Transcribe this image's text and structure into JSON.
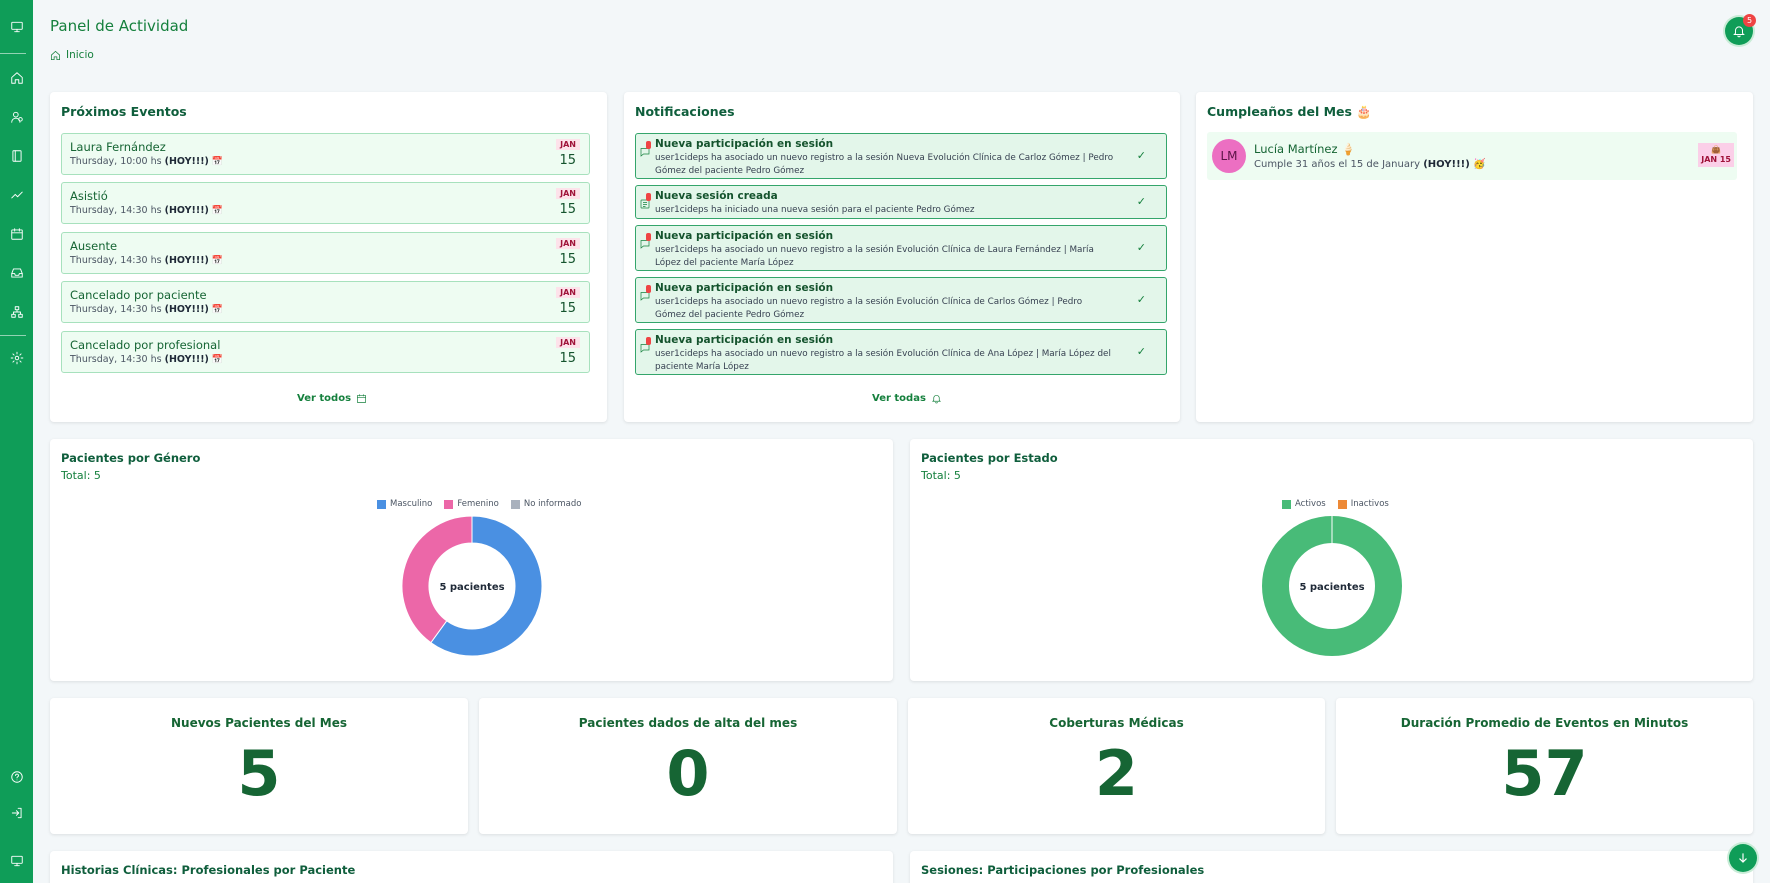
{
  "header": {
    "title": "Panel de Actividad",
    "breadcrumb": "Inicio",
    "notification_count": "5"
  },
  "sidebar": {
    "top_icons": [
      "monitor-icon"
    ],
    "items": [
      "home-icon",
      "patients-icon",
      "book-icon",
      "chart-icon",
      "calendar-icon",
      "inbox-icon",
      "sitemap-icon"
    ],
    "settings_icon": "gear-icon",
    "bottom_icons": [
      "help-icon",
      "logout-icon",
      "monitor-icon"
    ]
  },
  "events": {
    "title": "Próximos Eventos",
    "see_all": "Ver todos",
    "items": [
      {
        "name": "Laura Fernández",
        "time": "Thursday, 10:00 hs",
        "today": "(HOY!!!)",
        "month": "JAN",
        "day": "15"
      },
      {
        "name": "Asistió",
        "time": "Thursday, 14:30 hs",
        "today": "(HOY!!!)",
        "month": "JAN",
        "day": "15"
      },
      {
        "name": "Ausente",
        "time": "Thursday, 14:30 hs",
        "today": "(HOY!!!)",
        "month": "JAN",
        "day": "15"
      },
      {
        "name": "Cancelado por paciente",
        "time": "Thursday, 14:30 hs",
        "today": "(HOY!!!)",
        "month": "JAN",
        "day": "15"
      },
      {
        "name": "Cancelado por profesional",
        "time": "Thursday, 14:30 hs",
        "today": "(HOY!!!)",
        "month": "JAN",
        "day": "15"
      }
    ]
  },
  "notifications": {
    "title": "Notificaciones",
    "see_all": "Ver todas",
    "items": [
      {
        "icon": "chat-icon",
        "title": "Nueva participación en sesión",
        "text": "user1cideps ha asociado un nuevo registro a la sesión Nueva Evolución Clínica de Carloz Gómez | Pedro Gómez del paciente Pedro Gómez"
      },
      {
        "icon": "session-icon",
        "title": "Nueva sesión creada",
        "text": "user1cideps ha iniciado una nueva sesión para el paciente Pedro Gómez"
      },
      {
        "icon": "chat-icon",
        "title": "Nueva participación en sesión",
        "text": "user1cideps ha asociado un nuevo registro a la sesión Evolución Clínica de Laura Fernández | María López del paciente María López"
      },
      {
        "icon": "chat-icon",
        "title": "Nueva participación en sesión",
        "text": "user1cideps ha asociado un nuevo registro a la sesión Evolución Clínica de Carlos Gómez | Pedro Gómez del paciente Pedro Gómez"
      },
      {
        "icon": "chat-icon",
        "title": "Nueva participación en sesión",
        "text": "user1cideps ha asociado un nuevo registro a la sesión Evolución Clínica de Ana López | María López del paciente María López"
      }
    ]
  },
  "birthdays": {
    "title": "Cumpleaños del Mes 🎂",
    "items": [
      {
        "initials": "LM",
        "name": "Lucía Martínez 🍦",
        "text": "Cumple 31 años el 15 de January",
        "today": "(HOY!!!) 🥳",
        "date_icon": "👜",
        "date": "JAN 15"
      }
    ]
  },
  "charts_text": {
    "gender_title": "Pacientes por Género",
    "gender_total": "Total: 5",
    "gender_center": "5 pacientes",
    "status_title": "Pacientes por Estado",
    "status_total": "Total: 5",
    "status_center": "5 pacientes"
  },
  "chart_data": [
    {
      "type": "pie",
      "title": "Pacientes por Género",
      "categories": [
        "Masculino",
        "Femenino",
        "No informado"
      ],
      "values": [
        3,
        2,
        0
      ],
      "colors": [
        "#4a90e2",
        "#ec67a8",
        "#a9b1bd"
      ],
      "legend": "top"
    },
    {
      "type": "pie",
      "title": "Pacientes por Estado",
      "categories": [
        "Activos",
        "Inactivos"
      ],
      "values": [
        5,
        0
      ],
      "colors": [
        "#48bb78",
        "#ed8936"
      ],
      "legend": "top"
    }
  ],
  "stats": [
    {
      "title": "Nuevos Pacientes del Mes",
      "value": "5"
    },
    {
      "title": "Pacientes dados de alta del mes",
      "value": "0"
    },
    {
      "title": "Coberturas Médicas",
      "value": "2"
    },
    {
      "title": "Duración Promedio de Eventos en Minutos",
      "value": "57"
    }
  ],
  "bottom_sections": {
    "left_title": "Historias Clínicas: Profesionales por Paciente",
    "right_title": "Sesiones: Participaciones por Profesionales"
  }
}
